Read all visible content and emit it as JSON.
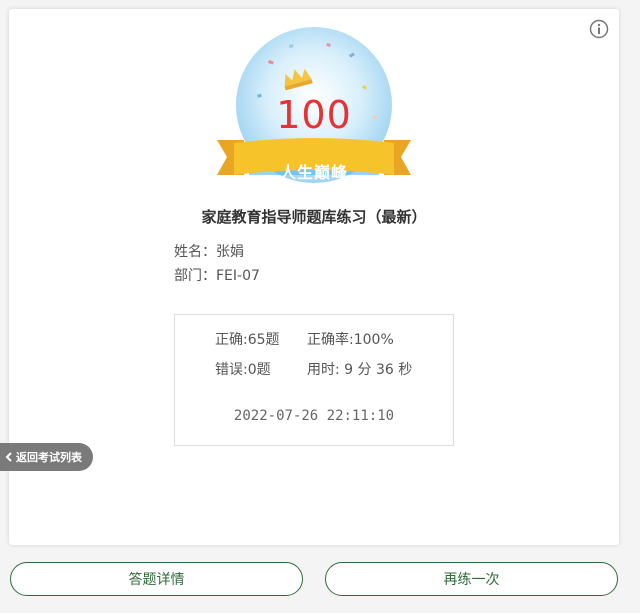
{
  "score": {
    "value": "100",
    "ribbon_label": "人生巅峰"
  },
  "exam": {
    "title": "家庭教育指导师题库练习（最新）"
  },
  "person": {
    "name_line": "姓名：张娟",
    "dept_line": "部门：FEI-07"
  },
  "stats": {
    "correct": "正确:65题",
    "accuracy": "正确率:100%",
    "wrong": "错误:0题",
    "time_used": "用时: 9 分 36 秒",
    "datetime": "2022-07-26 22:11:10"
  },
  "nav": {
    "back_label": "返回考试列表"
  },
  "buttons": {
    "details_label": "答题详情",
    "retry_label": "再练一次"
  },
  "colors": {
    "accent_green": "#2e6b3a",
    "score_red": "#e63232",
    "ribbon_yellow": "#f7c32b",
    "badge_blue": "#bfe3f7"
  },
  "icons": {
    "info": "info-icon",
    "back": "chevron-left-icon",
    "crown": "crown-icon"
  }
}
